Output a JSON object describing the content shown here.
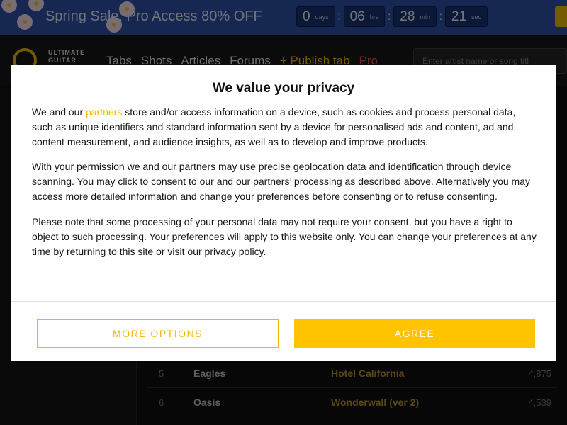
{
  "banner": {
    "text": "Spring Sale: Pro Access 80% OFF",
    "countdown": [
      {
        "value": "0",
        "unit": "days"
      },
      {
        "value": "06",
        "unit": "hrs"
      },
      {
        "value": "28",
        "unit": "min"
      },
      {
        "value": "21",
        "unit": "sec"
      }
    ]
  },
  "header": {
    "logo_line1": "ULTIMATE",
    "logo_line2": "GUITAR",
    "nav": [
      "Tabs",
      "Shots",
      "Articles",
      "Forums"
    ],
    "publish_label": "+ Publish tab",
    "pro_label": "Pro",
    "search_placeholder": "Enter artist name or song titl"
  },
  "songs": [
    {
      "rank": "5",
      "artist": "Eagles",
      "title": "Hotel California",
      "count": "4,875"
    },
    {
      "rank": "6",
      "artist": "Oasis",
      "title": "Wonderwall (ver 2)",
      "count": "4,539"
    }
  ],
  "consent": {
    "title": "We value your privacy",
    "p1_before": "We and our ",
    "p1_link": "partners",
    "p1_after": " store and/or access information on a device, such as cookies and process personal data, such as unique identifiers and standard information sent by a device for personalised ads and content, ad and content measurement, and audience insights, as well as to develop and improve products.",
    "p2": "With your permission we and our partners may use precise geolocation data and identification through device scanning. You may click to consent to our and our partners’ processing as described above. Alternatively you may access more detailed information and change your preferences before consenting or to refuse consenting.",
    "p3": "Please note that some processing of your personal data may not require your consent, but you have a right to object to such processing. Your preferences will apply to this website only. You can change your preferences at any time by returning to this site or visit our privacy policy.",
    "more_options_label": "MORE OPTIONS",
    "agree_label": "AGREE"
  },
  "colors": {
    "accent": "#ffc300",
    "banner_bg": "#2c4fa4",
    "link_song": "#b9902a",
    "pro": "#e84848"
  }
}
